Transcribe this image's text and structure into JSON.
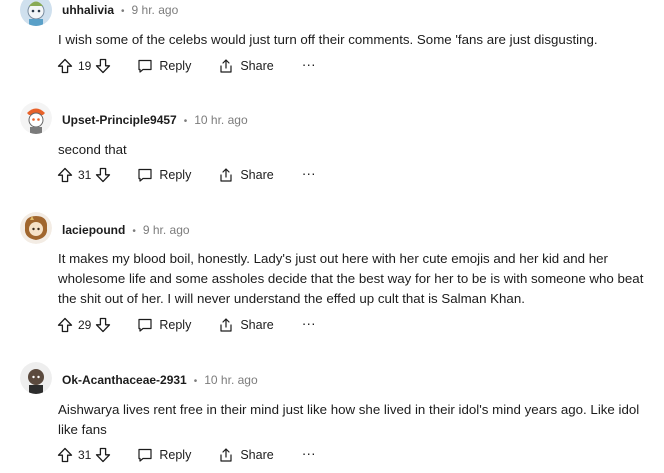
{
  "comments": [
    {
      "username": "uhhalivia",
      "time": "9 hr. ago",
      "text": "I wish some of the celebs would just turn off their comments. Some 'fans are just disgusting.",
      "votes": "19",
      "reply": "Reply",
      "share": "Share",
      "more": "···"
    },
    {
      "username": "Upset-Principle9457",
      "time": "10 hr. ago",
      "text": "second that",
      "votes": "31",
      "reply": "Reply",
      "share": "Share",
      "more": "···"
    },
    {
      "username": "laciepound",
      "time": "9 hr. ago",
      "text": "It makes my blood boil, honestly. Lady's just out here with her cute emojis and her kid and her wholesome life and some assholes decide that the best way for her to be is with someone who beat the shit out of her. I will never understand the effed up cult that is Salman Khan.",
      "votes": "29",
      "reply": "Reply",
      "share": "Share",
      "more": "···"
    },
    {
      "username": "Ok-Acanthaceae-2931",
      "time": "10 hr. ago",
      "text": "Aishwarya lives rent free in their mind just like how she lived in their idol's mind years ago. Like idol like fans",
      "votes": "31",
      "reply": "Reply",
      "share": "Share",
      "more": "···"
    }
  ],
  "colors": {
    "text": "#1c1c1c",
    "meta": "#7c7c7c",
    "background": "#ffffff"
  }
}
